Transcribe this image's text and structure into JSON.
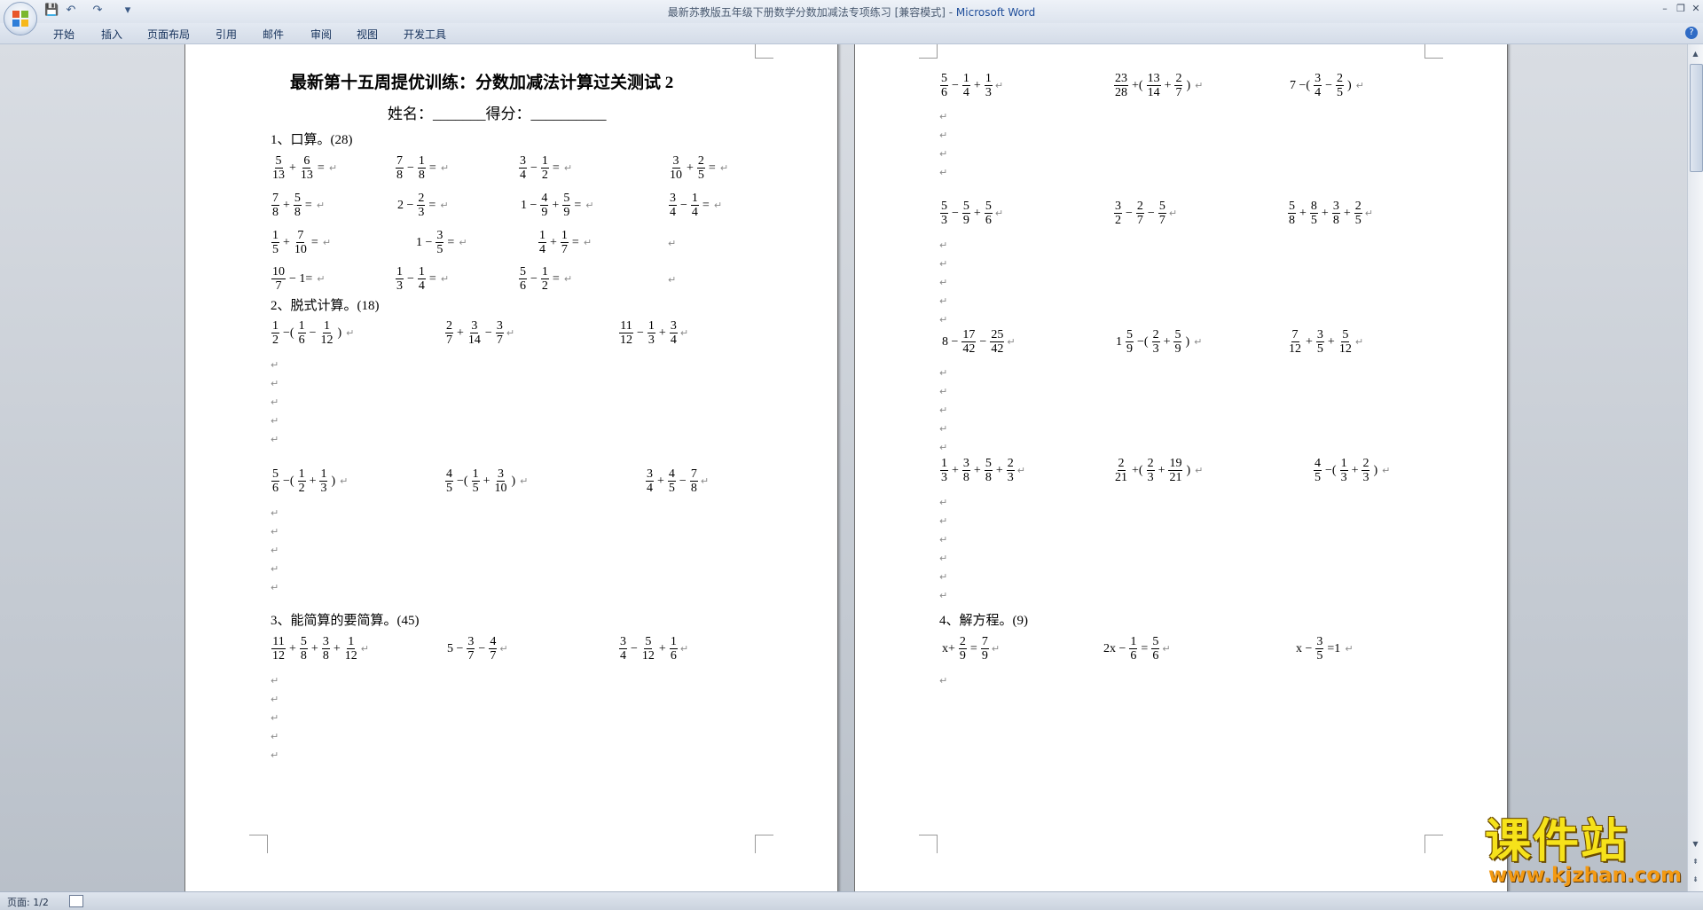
{
  "window": {
    "title": "最新苏教版五年级下册数学分数加减法专项练习 [兼容模式] - ",
    "app_name": "Microsoft Word",
    "controls": {
      "minimize": "–",
      "restore": "❐",
      "close": "✕"
    }
  },
  "quick_access": {
    "save_icon": "💾",
    "undo_icon": "↶",
    "redo_icon": "↷",
    "more_icon": "▾"
  },
  "ribbon_tabs": [
    "开始",
    "插入",
    "页面布局",
    "引用",
    "邮件",
    "审阅",
    "视图",
    "开发工具"
  ],
  "help": "?",
  "paragraph_mark": "↵",
  "page1": {
    "title": "最新第十五周提优训练：分数加减法计算过关测试 2",
    "name_line": "姓名：_______得分：__________",
    "section1": "1、口算。(28)",
    "section2": "2、脱式计算。(18)",
    "section3": "3、能简算的要简算。(45)"
  },
  "page2": {
    "section4": "4、解方程。(9)"
  },
  "expressions": {
    "p1_r1_a": [
      [
        "f",
        "5",
        "13"
      ],
      [
        "o",
        "+"
      ],
      [
        "f",
        "6",
        "13"
      ],
      [
        "o",
        "="
      ]
    ],
    "p1_r1_b": [
      [
        "f",
        "7",
        "8"
      ],
      [
        "o",
        "−"
      ],
      [
        "f",
        "1",
        "8"
      ],
      [
        "o",
        "="
      ]
    ],
    "p1_r1_c": [
      [
        "f",
        "3",
        "4"
      ],
      [
        "o",
        "−"
      ],
      [
        "f",
        "1",
        "2"
      ],
      [
        "o",
        "="
      ]
    ],
    "p1_r1_d": [
      [
        "f",
        "3",
        "10"
      ],
      [
        "o",
        "+"
      ],
      [
        "f",
        "2",
        "5"
      ],
      [
        "o",
        "="
      ]
    ],
    "p1_r2_a": [
      [
        "f",
        "7",
        "8"
      ],
      [
        "o",
        "+"
      ],
      [
        "f",
        "5",
        "8"
      ],
      [
        "o",
        "="
      ]
    ],
    "p1_r2_b": [
      [
        "o",
        "2 −"
      ],
      [
        "f",
        "2",
        "3"
      ],
      [
        "o",
        "="
      ]
    ],
    "p1_r2_c": [
      [
        "o",
        "1 −"
      ],
      [
        "f",
        "4",
        "9"
      ],
      [
        "o",
        "+"
      ],
      [
        "f",
        "5",
        "9"
      ],
      [
        "o",
        "="
      ]
    ],
    "p1_r2_d": [
      [
        "f",
        "3",
        "4"
      ],
      [
        "o",
        "−"
      ],
      [
        "f",
        "1",
        "4"
      ],
      [
        "o",
        "="
      ]
    ],
    "p1_r3_a": [
      [
        "f",
        "1",
        "5"
      ],
      [
        "o",
        "+"
      ],
      [
        "f",
        "7",
        "10"
      ],
      [
        "o",
        "="
      ]
    ],
    "p1_r3_b": [
      [
        "o",
        "1 −"
      ],
      [
        "f",
        "3",
        "5"
      ],
      [
        "o",
        "="
      ]
    ],
    "p1_r3_c": [
      [
        "f",
        "1",
        "4"
      ],
      [
        "o",
        "+"
      ],
      [
        "f",
        "1",
        "7"
      ],
      [
        "o",
        "="
      ]
    ],
    "p1_r4_a": [
      [
        "f",
        "10",
        "7"
      ],
      [
        "o",
        "− 1="
      ]
    ],
    "p1_r4_b": [
      [
        "f",
        "1",
        "3"
      ],
      [
        "o",
        "−"
      ],
      [
        "f",
        "1",
        "4"
      ],
      [
        "o",
        "="
      ]
    ],
    "p1_r4_c": [
      [
        "f",
        "5",
        "6"
      ],
      [
        "o",
        "−"
      ],
      [
        "f",
        "1",
        "2"
      ],
      [
        "o",
        "="
      ]
    ],
    "p1_s2_a": [
      [
        "f",
        "1",
        "2"
      ],
      [
        "o",
        "−("
      ],
      [
        "f",
        "1",
        "6"
      ],
      [
        "o",
        "−"
      ],
      [
        "f",
        "1",
        "12"
      ],
      [
        "o",
        ")"
      ]
    ],
    "p1_s2_b": [
      [
        "f",
        "2",
        "7"
      ],
      [
        "o",
        "+"
      ],
      [
        "f",
        "3",
        "14"
      ],
      [
        "o",
        "−"
      ],
      [
        "f",
        "3",
        "7"
      ]
    ],
    "p1_s2_c": [
      [
        "f",
        "11",
        "12"
      ],
      [
        "o",
        "−"
      ],
      [
        "f",
        "1",
        "3"
      ],
      [
        "o",
        "+"
      ],
      [
        "f",
        "3",
        "4"
      ]
    ],
    "p1_s2_d": [
      [
        "f",
        "5",
        "6"
      ],
      [
        "o",
        "−("
      ],
      [
        "f",
        "1",
        "2"
      ],
      [
        "o",
        "+"
      ],
      [
        "f",
        "1",
        "3"
      ],
      [
        "o",
        ")"
      ]
    ],
    "p1_s2_e": [
      [
        "f",
        "4",
        "5"
      ],
      [
        "o",
        "−("
      ],
      [
        "f",
        "1",
        "5"
      ],
      [
        "o",
        "+"
      ],
      [
        "f",
        "3",
        "10"
      ],
      [
        "o",
        ")"
      ]
    ],
    "p1_s2_f": [
      [
        "f",
        "3",
        "4"
      ],
      [
        "o",
        "+"
      ],
      [
        "f",
        "4",
        "5"
      ],
      [
        "o",
        "−"
      ],
      [
        "f",
        "7",
        "8"
      ]
    ],
    "p1_s3_a": [
      [
        "f",
        "11",
        "12"
      ],
      [
        "o",
        "+"
      ],
      [
        "f",
        "5",
        "8"
      ],
      [
        "o",
        "+"
      ],
      [
        "f",
        "3",
        "8"
      ],
      [
        "o",
        "+"
      ],
      [
        "f",
        "1",
        "12"
      ]
    ],
    "p1_s3_b": [
      [
        "o",
        "5 −"
      ],
      [
        "f",
        "3",
        "7"
      ],
      [
        "o",
        "−"
      ],
      [
        "f",
        "4",
        "7"
      ]
    ],
    "p1_s3_c": [
      [
        "f",
        "3",
        "4"
      ],
      [
        "o",
        "−"
      ],
      [
        "f",
        "5",
        "12"
      ],
      [
        "o",
        "+"
      ],
      [
        "f",
        "1",
        "6"
      ]
    ],
    "p2_r1_a": [
      [
        "f",
        "5",
        "6"
      ],
      [
        "o",
        "−"
      ],
      [
        "f",
        "1",
        "4"
      ],
      [
        "o",
        "+"
      ],
      [
        "f",
        "1",
        "3"
      ]
    ],
    "p2_r1_b": [
      [
        "f",
        "23",
        "28"
      ],
      [
        "o",
        "+("
      ],
      [
        "f",
        "13",
        "14"
      ],
      [
        "o",
        "+"
      ],
      [
        "f",
        "2",
        "7"
      ],
      [
        "o",
        ")"
      ]
    ],
    "p2_r1_c": [
      [
        "o",
        "7 −("
      ],
      [
        "f",
        "3",
        "4"
      ],
      [
        "o",
        "−"
      ],
      [
        "f",
        "2",
        "5"
      ],
      [
        "o",
        ")"
      ]
    ],
    "p2_r2_a": [
      [
        "f",
        "5",
        "3"
      ],
      [
        "o",
        "−"
      ],
      [
        "f",
        "5",
        "9"
      ],
      [
        "o",
        "+"
      ],
      [
        "f",
        "5",
        "6"
      ]
    ],
    "p2_r2_b": [
      [
        "f",
        "3",
        "2"
      ],
      [
        "o",
        "−"
      ],
      [
        "f",
        "2",
        "7"
      ],
      [
        "o",
        "−"
      ],
      [
        "f",
        "5",
        "7"
      ]
    ],
    "p2_r2_c": [
      [
        "f",
        "5",
        "8"
      ],
      [
        "o",
        "+"
      ],
      [
        "f",
        "8",
        "5"
      ],
      [
        "o",
        "+"
      ],
      [
        "f",
        "3",
        "8"
      ],
      [
        "o",
        "+"
      ],
      [
        "f",
        "2",
        "5"
      ]
    ],
    "p2_r3_a": [
      [
        "o",
        "8 −"
      ],
      [
        "f",
        "17",
        "42"
      ],
      [
        "o",
        "−"
      ],
      [
        "f",
        "25",
        "42"
      ]
    ],
    "p2_r3_b": [
      [
        "o",
        "1"
      ],
      [
        "f",
        "5",
        "9"
      ],
      [
        "o",
        "−("
      ],
      [
        "f",
        "2",
        "3"
      ],
      [
        "o",
        "+"
      ],
      [
        "f",
        "5",
        "9"
      ],
      [
        "o",
        ")"
      ]
    ],
    "p2_r3_c": [
      [
        "f",
        "7",
        "12"
      ],
      [
        "o",
        "+"
      ],
      [
        "f",
        "3",
        "5"
      ],
      [
        "o",
        "+"
      ],
      [
        "f",
        "5",
        "12"
      ]
    ],
    "p2_r4_a": [
      [
        "f",
        "1",
        "3"
      ],
      [
        "o",
        "+"
      ],
      [
        "f",
        "3",
        "8"
      ],
      [
        "o",
        "+"
      ],
      [
        "f",
        "5",
        "8"
      ],
      [
        "o",
        "+"
      ],
      [
        "f",
        "2",
        "3"
      ]
    ],
    "p2_r4_b": [
      [
        "f",
        "2",
        "21"
      ],
      [
        "o",
        "+("
      ],
      [
        "f",
        "2",
        "3"
      ],
      [
        "o",
        "+"
      ],
      [
        "f",
        "19",
        "21"
      ],
      [
        "o",
        ")"
      ]
    ],
    "p2_r4_c": [
      [
        "f",
        "4",
        "5"
      ],
      [
        "o",
        "−("
      ],
      [
        "f",
        "1",
        "3"
      ],
      [
        "o",
        "+"
      ],
      [
        "f",
        "2",
        "3"
      ],
      [
        "o",
        ")"
      ]
    ],
    "p2_eq_a": [
      [
        "o",
        "x+"
      ],
      [
        "f",
        "2",
        "9"
      ],
      [
        "o",
        "="
      ],
      [
        "f",
        "7",
        "9"
      ]
    ],
    "p2_eq_b": [
      [
        "o",
        "2x −"
      ],
      [
        "f",
        "1",
        "6"
      ],
      [
        "o",
        "="
      ],
      [
        "f",
        "5",
        "6"
      ]
    ],
    "p2_eq_c": [
      [
        "o",
        "x −"
      ],
      [
        "f",
        "3",
        "5"
      ],
      [
        "o",
        "=1"
      ]
    ]
  },
  "status": {
    "page": "页面: 1/2"
  },
  "watermark": {
    "title": "课件站",
    "url": "www.kjzhan.com"
  }
}
